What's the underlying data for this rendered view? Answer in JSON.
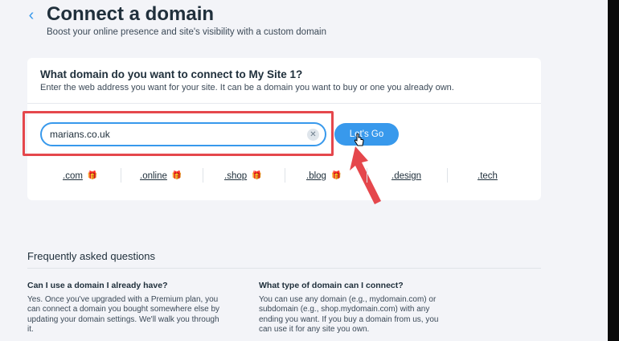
{
  "header": {
    "back_icon": "chevron-left-icon",
    "title": "Connect a domain",
    "subtitle": "Boost your online presence and site's visibility with a custom domain"
  },
  "card": {
    "title": "What domain do you want to connect to My Site 1?",
    "description": "Enter the web address you want for your site. It can be a domain you want to buy or one you already own.",
    "input_value": "marians.co.uk",
    "clear_icon": "close-icon",
    "go_label": "Let's Go"
  },
  "tlds": [
    {
      "label": ".com",
      "gift": true
    },
    {
      "label": ".online",
      "gift": true
    },
    {
      "label": ".shop",
      "gift": true
    },
    {
      "label": ".blog",
      "gift": true
    },
    {
      "label": ".design",
      "gift": false
    },
    {
      "label": ".tech",
      "gift": false
    }
  ],
  "faq": {
    "title": "Frequently asked questions",
    "items": [
      {
        "question": "Can I use a domain I already have?",
        "answer": "Yes. Once you've upgraded with a Premium plan, you can connect a domain you bought somewhere else by updating your domain settings. We'll walk you through it."
      },
      {
        "question": "What type of domain can I connect?",
        "answer": "You can use any domain (e.g., mydomain.com) or subdomain (e.g., shop.mydomain.com) with any ending you want. If you buy a domain from us, you can use it for any site you own."
      }
    ]
  },
  "colors": {
    "accent": "#3899ec",
    "highlight": "#e5474c",
    "gift": "#9c53d0"
  }
}
